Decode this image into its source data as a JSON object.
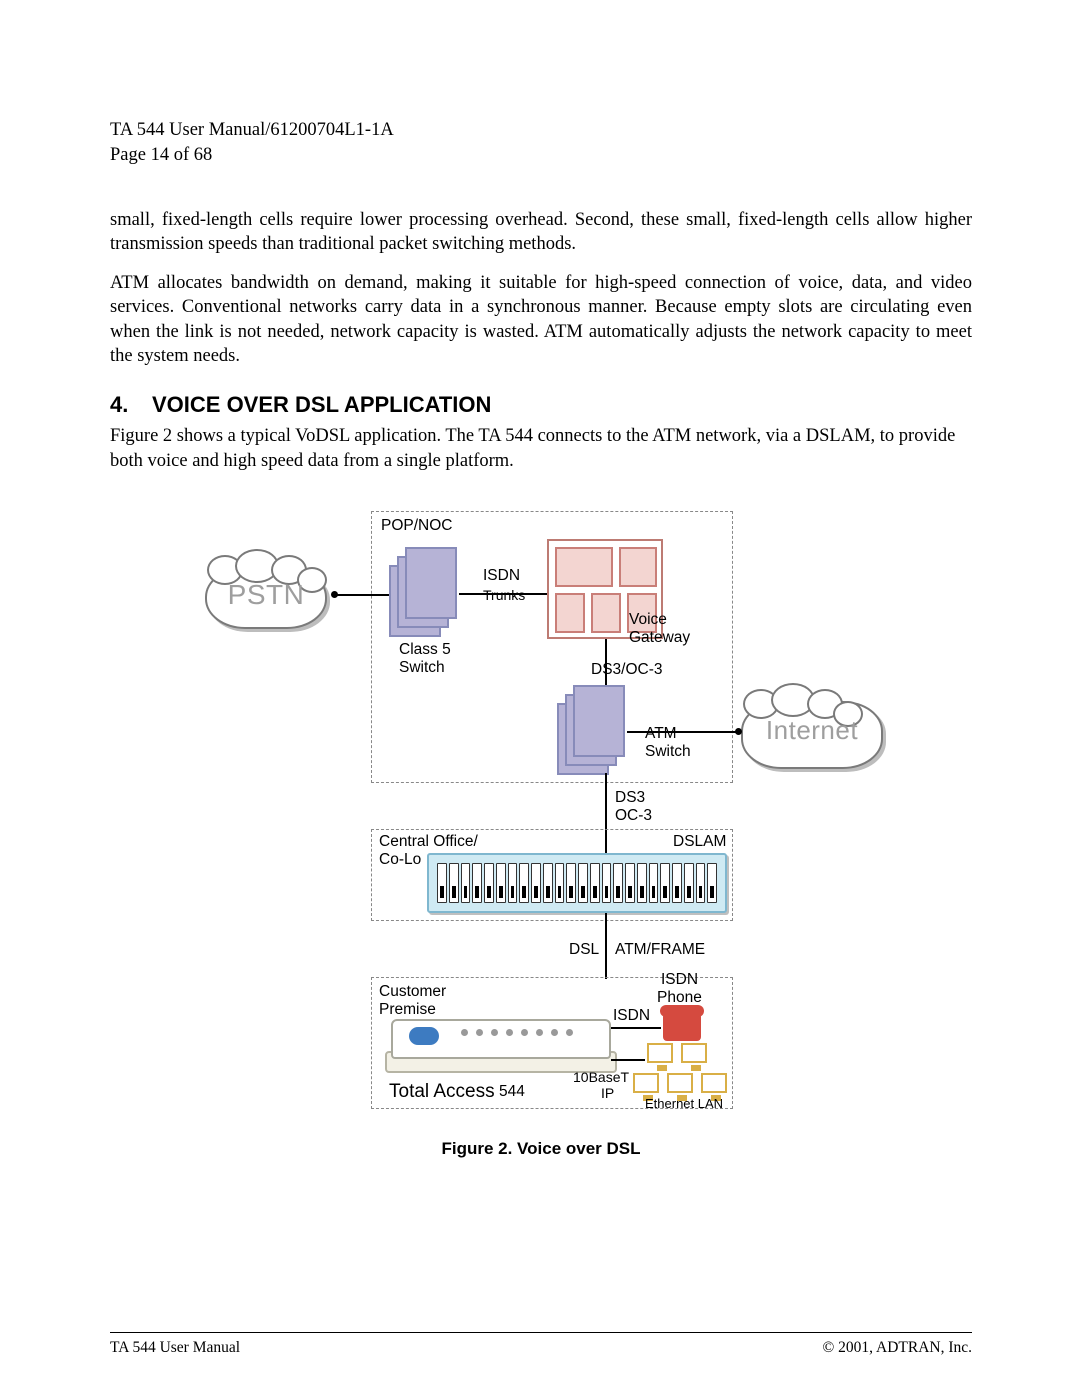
{
  "header": {
    "doc_title": "TA 544 User Manual/61200704L1-1A",
    "page_indicator": "Page 14 of 68"
  },
  "paragraphs": {
    "p1": "small, fixed-length cells require lower processing overhead. Second, these small, fixed-length cells allow higher transmission speeds than traditional packet switching methods.",
    "p2": "ATM allocates bandwidth on demand, making it suitable for high-speed connection of voice, data, and video services. Conventional networks carry data in a synchronous manner. Because empty slots are circulating even when the link is not needed, network capacity is wasted. ATM automatically adjusts the network capacity to meet the system needs."
  },
  "section": {
    "number": "4.",
    "title": "VOICE OVER DSL APPLICATION",
    "intro": "Figure 2 shows a typical VoDSL application. The TA 544 connects to the ATM network, via a DSLAM, to provide both voice and high speed data from a single platform."
  },
  "diagram": {
    "clouds": {
      "pstn": "PSTN",
      "internet": "Internet"
    },
    "boxes": {
      "pop_noc": "POP/NOC",
      "central_office": "Central Office/\nCo-Lo",
      "customer_premise": "Customer\nPremise"
    },
    "labels": {
      "isdn_trunks_1": "ISDN",
      "isdn_trunks_2": "Trunks",
      "class5_1": "Class 5",
      "class5_2": "Switch",
      "voice_gateway_1": "Voice",
      "voice_gateway_2": "Gateway",
      "ds3_oc3_top": "DS3/OC-3",
      "atm_switch_1": "ATM",
      "atm_switch_2": "Switch",
      "ds3_oc3_mid_1": "DS3",
      "ds3_oc3_mid_2": "OC-3",
      "dslam": "DSLAM",
      "dsl": "DSL",
      "atm_frame": "ATM/FRAME",
      "isdn_right_1": "ISDN",
      "isdn_phone_1": "ISDN",
      "isdn_phone_2": "Phone",
      "ten_baset": "10BaseT",
      "ip": "IP",
      "ethernet_lan": "Ethernet LAN",
      "total_access": "Total Access",
      "ta_model": "544"
    }
  },
  "figure_caption": "Figure 2.  Voice over DSL",
  "footer": {
    "left": "TA 544 User Manual",
    "right": "© 2001, ADTRAN, Inc."
  }
}
